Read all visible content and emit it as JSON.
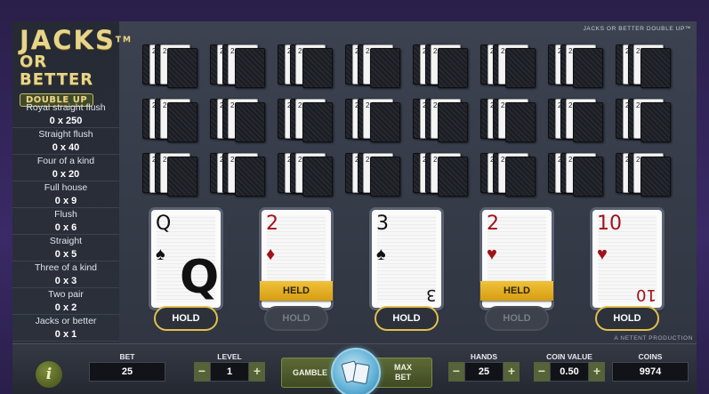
{
  "game": {
    "logo_line1": "JACKS",
    "logo_tm": "TM",
    "logo_line2": "OR BETTER",
    "logo_line3": "DOUBLE UP",
    "brand_top": "JACKS OR BETTER DOUBLE UP™",
    "brand_bottom": "A NETENT PRODUCTION"
  },
  "paytable": [
    {
      "name": "Royal straight flush",
      "value": "0 x 250"
    },
    {
      "name": "Straight flush",
      "value": "0 x 40"
    },
    {
      "name": "Four of a kind",
      "value": "0 x 20"
    },
    {
      "name": "Full house",
      "value": "0 x 9"
    },
    {
      "name": "Flush",
      "value": "0 x 6"
    },
    {
      "name": "Straight",
      "value": "0 x 5"
    },
    {
      "name": "Three of a kind",
      "value": "0 x 3"
    },
    {
      "name": "Two pair",
      "value": "0 x 2"
    },
    {
      "name": "Jacks or better",
      "value": "0 x 1"
    }
  ],
  "cards": [
    {
      "rank": "Q",
      "suit": "♠",
      "color": "black",
      "held": false,
      "big": "Q"
    },
    {
      "rank": "2",
      "suit": "♦",
      "color": "red",
      "held": true
    },
    {
      "rank": "3",
      "suit": "♠",
      "color": "black",
      "held": false,
      "inv": "3"
    },
    {
      "rank": "2",
      "suit": "♥",
      "color": "red",
      "held": true
    },
    {
      "rank": "10",
      "suit": "♥",
      "color": "red",
      "held": false,
      "inv": "10"
    }
  ],
  "held_label": "HELD",
  "hold_label": "HOLD",
  "bottom": {
    "info_icon": "i",
    "bet_label": "BET",
    "bet_value": "25",
    "level_label": "LEVEL",
    "level_value": "1",
    "minus": "−",
    "plus": "+",
    "gamble_label": "GAMBLE",
    "maxbet_line1": "MAX",
    "maxbet_line2": "BET",
    "hands_label": "HANDS",
    "hands_value": "25",
    "coinvalue_label": "COIN VALUE",
    "coinvalue_value": "0.50",
    "coins_label": "COINS",
    "coins_value": "9974"
  },
  "colors": {
    "accent_gold": "#e1c04a",
    "button_green": "#55623a",
    "deal_blue": "#5fb0d6"
  }
}
